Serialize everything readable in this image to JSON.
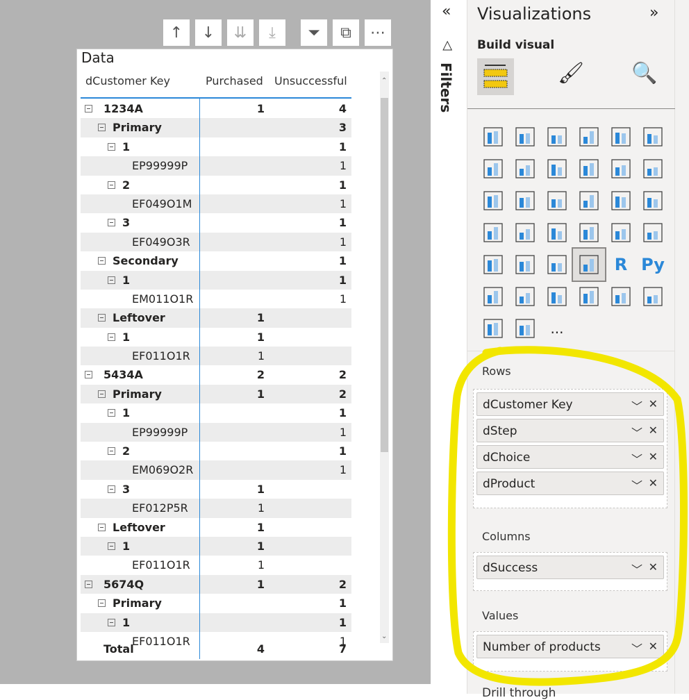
{
  "toolbar": {
    "buttons": [
      "arrow-up",
      "arrow-down",
      "double-arrow-down",
      "expand-hierarchy",
      "filter",
      "focus-mode",
      "more-options"
    ]
  },
  "visual": {
    "title": "Data",
    "columns": [
      "dCustomer Key",
      "Purchased",
      "Unsuccessful"
    ],
    "rows": [
      {
        "level": 0,
        "label": "1234A",
        "purchased": "1",
        "unsuccessful": "4"
      },
      {
        "level": 1,
        "label": "Primary",
        "purchased": "",
        "unsuccessful": "3"
      },
      {
        "level": 2,
        "label": "1",
        "purchased": "",
        "unsuccessful": "1"
      },
      {
        "level": 3,
        "label": "EP99999P",
        "purchased": "",
        "unsuccessful": "1"
      },
      {
        "level": 2,
        "label": "2",
        "purchased": "",
        "unsuccessful": "1"
      },
      {
        "level": 3,
        "label": "EF049O1M",
        "purchased": "",
        "unsuccessful": "1"
      },
      {
        "level": 2,
        "label": "3",
        "purchased": "",
        "unsuccessful": "1"
      },
      {
        "level": 3,
        "label": "EF049O3R",
        "purchased": "",
        "unsuccessful": "1"
      },
      {
        "level": 1,
        "label": "Secondary",
        "purchased": "",
        "unsuccessful": "1"
      },
      {
        "level": 2,
        "label": "1",
        "purchased": "",
        "unsuccessful": "1"
      },
      {
        "level": 3,
        "label": "EM011O1R",
        "purchased": "",
        "unsuccessful": "1"
      },
      {
        "level": 1,
        "label": "Leftover",
        "purchased": "1",
        "unsuccessful": ""
      },
      {
        "level": 2,
        "label": "1",
        "purchased": "1",
        "unsuccessful": ""
      },
      {
        "level": 3,
        "label": "EF011O1R",
        "purchased": "1",
        "unsuccessful": ""
      },
      {
        "level": 0,
        "label": "5434A",
        "purchased": "2",
        "unsuccessful": "2"
      },
      {
        "level": 1,
        "label": "Primary",
        "purchased": "1",
        "unsuccessful": "2"
      },
      {
        "level": 2,
        "label": "1",
        "purchased": "",
        "unsuccessful": "1"
      },
      {
        "level": 3,
        "label": "EP99999P",
        "purchased": "",
        "unsuccessful": "1"
      },
      {
        "level": 2,
        "label": "2",
        "purchased": "",
        "unsuccessful": "1"
      },
      {
        "level": 3,
        "label": "EM069O2R",
        "purchased": "",
        "unsuccessful": "1"
      },
      {
        "level": 2,
        "label": "3",
        "purchased": "1",
        "unsuccessful": ""
      },
      {
        "level": 3,
        "label": "EF012P5R",
        "purchased": "1",
        "unsuccessful": ""
      },
      {
        "level": 1,
        "label": "Leftover",
        "purchased": "1",
        "unsuccessful": ""
      },
      {
        "level": 2,
        "label": "1",
        "purchased": "1",
        "unsuccessful": ""
      },
      {
        "level": 3,
        "label": "EF011O1R",
        "purchased": "1",
        "unsuccessful": ""
      },
      {
        "level": 0,
        "label": "5674Q",
        "purchased": "1",
        "unsuccessful": "2"
      },
      {
        "level": 1,
        "label": "Primary",
        "purchased": "",
        "unsuccessful": "1"
      },
      {
        "level": 2,
        "label": "1",
        "purchased": "",
        "unsuccessful": "1"
      },
      {
        "level": 3,
        "label": "EF011O1R",
        "purchased": "",
        "unsuccessful": "1"
      }
    ],
    "total": {
      "label": "Total",
      "purchased": "4",
      "unsuccessful": "7"
    }
  },
  "filters": {
    "label": "Filters"
  },
  "visualizations": {
    "title": "Visualizations",
    "build_visual": "Build visual",
    "more_label": "...",
    "rows_label": "Rows",
    "rows_fields": [
      "dCustomer Key",
      "dStep",
      "dChoice",
      "dProduct"
    ],
    "columns_label": "Columns",
    "columns_fields": [
      "dSuccess"
    ],
    "values_label": "Values",
    "values_fields": [
      "Number of products"
    ],
    "drill_through": "Drill through"
  },
  "colors": {
    "accent": "#2b88d8",
    "highlight": "#f2e600",
    "selected_icon": "#f2c811"
  }
}
